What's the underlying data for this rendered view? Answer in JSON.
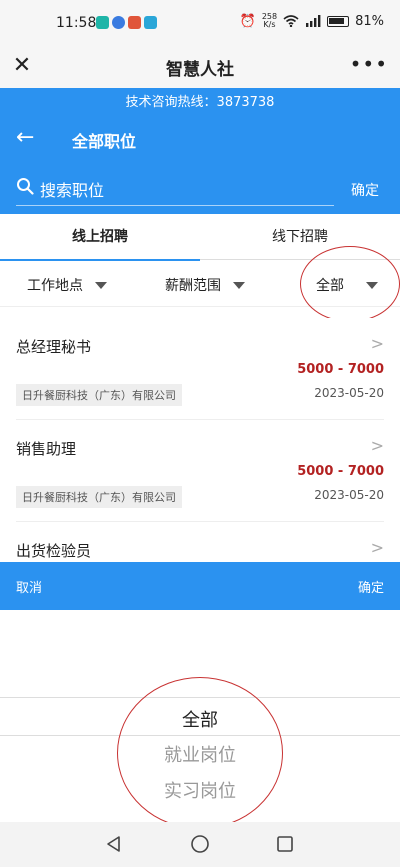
{
  "status_bar": {
    "time": "11:58",
    "net_speed_value": "258",
    "net_speed_unit": "K/s",
    "battery": "81%"
  },
  "title_bar": {
    "title": "智慧人社",
    "more": "•••"
  },
  "header": {
    "hotline": "技术咨询热线：3873738",
    "page_title": "全部职位",
    "search_placeholder": "搜索职位",
    "confirm_label": "确定",
    "brand_color": "#2b92f0"
  },
  "tabs": [
    {
      "label": "线上招聘",
      "active": true
    },
    {
      "label": "线下招聘",
      "active": false
    }
  ],
  "filters": [
    {
      "label": "工作地点"
    },
    {
      "label": "薪酬范围"
    },
    {
      "label": "全部"
    }
  ],
  "jobs": [
    {
      "title": "总经理秘书",
      "salary": "5000 - 7000",
      "company": "日升餐厨科技（广东）有限公司",
      "date": "2023-05-20"
    },
    {
      "title": "销售助理",
      "salary": "5000 - 7000",
      "company": "日升餐厨科技（广东）有限公司",
      "date": "2023-05-20"
    },
    {
      "title": "出货检验员"
    }
  ],
  "action_bar": {
    "cancel_label": "取消",
    "ok_label": "确定"
  },
  "picker": {
    "options": [
      "全部",
      "就业岗位",
      "实习岗位"
    ],
    "selected_index": 0
  },
  "colors": {
    "salary": "#b32222",
    "annotation_circle": "#c83232"
  }
}
